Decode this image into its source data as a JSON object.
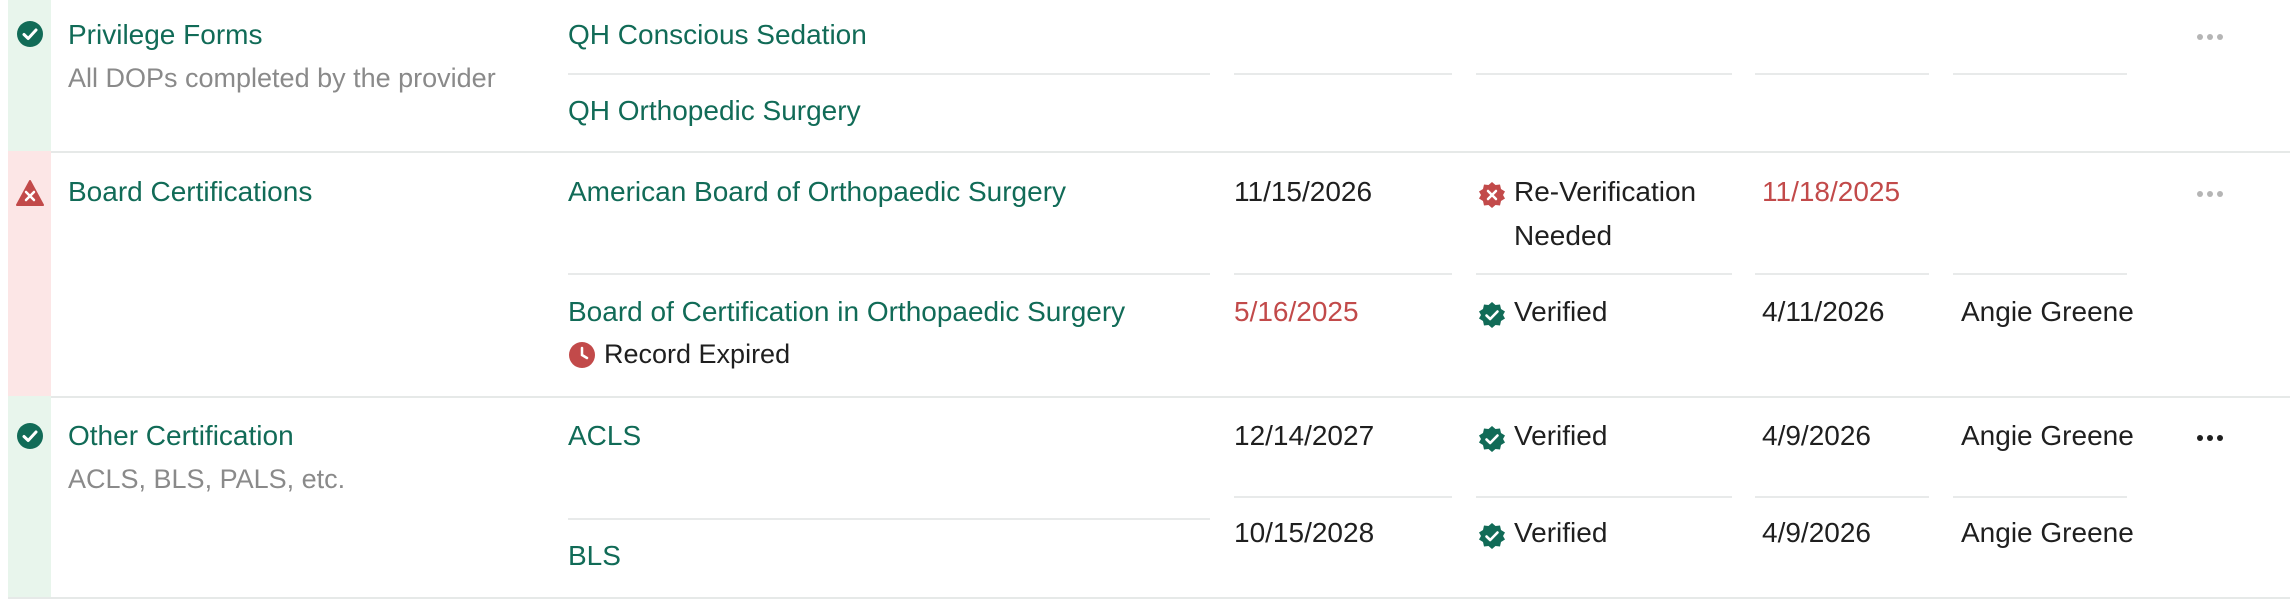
{
  "groups": [
    {
      "title": "Privilege Forms",
      "subtitle": "All DOPs completed by the provider",
      "status": "complete",
      "records": [
        {
          "name": "QH Conscious Sedation"
        },
        {
          "name": "QH Orthopedic Surgery"
        }
      ]
    },
    {
      "title": "Board Certifications",
      "status": "issue",
      "records": [
        {
          "name": "American Board of Orthopaedic Surgery",
          "expiration": "11/15/2026",
          "verification": "Re-Verification Needed",
          "verification_line1": "Re-Verification",
          "verification_line2": "Needed",
          "verified_date": "11/18/2025"
        },
        {
          "name": "Board of Certification in Orthopaedic Surgery",
          "flag": "Record Expired",
          "expiration": "5/16/2025",
          "verification": "Verified",
          "verified_date": "4/11/2026",
          "verified_by": "Angie Greene"
        }
      ]
    },
    {
      "title": "Other Certification",
      "subtitle": "ACLS, BLS, PALS, etc.",
      "status": "complete",
      "records": [
        {
          "name": "ACLS",
          "expiration": "12/14/2027",
          "verification": "Verified",
          "verified_date": "4/9/2026",
          "verified_by": "Angie Greene"
        },
        {
          "name": "BLS",
          "expiration": "10/15/2028",
          "verification": "Verified",
          "verified_date": "4/9/2026",
          "verified_by": "Angie Greene"
        }
      ]
    }
  ],
  "colors": {
    "brand_green": "#116b57",
    "alert_red": "#c24a4a",
    "complete_stripe": "#e8f5ec",
    "issue_stripe": "#fce6e6"
  },
  "icons": {
    "complete": "check-circle-icon",
    "issue": "x-warning-icon",
    "verified": "verified-badge-icon",
    "reverify": "x-badge-icon",
    "expired": "clock-icon",
    "menu": "ellipsis-icon"
  }
}
